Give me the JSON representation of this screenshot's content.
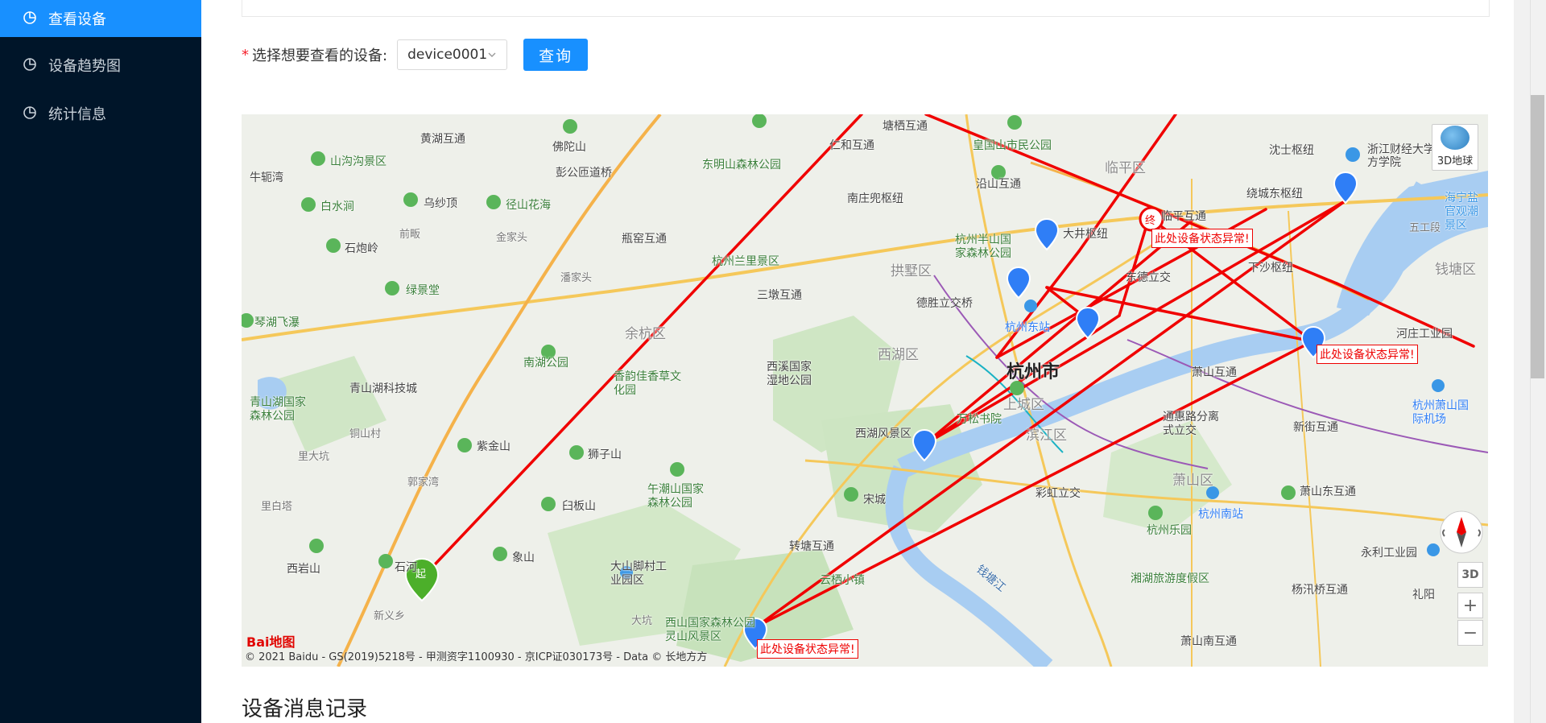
{
  "sidebar": {
    "items": [
      {
        "label": "查看设备",
        "icon": "pie-chart-icon",
        "active": true
      },
      {
        "label": "设备趋势图",
        "icon": "pie-chart-icon",
        "active": false
      },
      {
        "label": "统计信息",
        "icon": "pie-chart-icon",
        "active": false
      }
    ]
  },
  "query": {
    "required_mark": "*",
    "label": "选择想要查看的设备:",
    "selected_device": "device0001",
    "button_label": "查询"
  },
  "map": {
    "title_3d": "3D地球",
    "ctrl_3d": "3D",
    "zoom_in": "+",
    "zoom_out": "−",
    "start_marker": "起",
    "end_marker": "终",
    "alert_text": "此处设备状态异常!",
    "city": "杭州市",
    "copyright": "© 2021 Baidu - GS(2019)5218号 - 甲测资字1100930 - 京ICP证030173号 - Data © 长地方方",
    "logo": "Bai地图",
    "labels": {
      "l1": "黄湖互通",
      "l2": "佛陀山",
      "l3": "塘栖互通",
      "l4": "仁和互通",
      "l5": "皇国山市民公园",
      "l6": "沈士枢纽",
      "l7": "浙江财经大学东方学院",
      "l8": "牛轭湾",
      "l9": "山沟沟景区",
      "l10": "彭公匝道桥",
      "l11": "东明山森林公园",
      "l12": "南庄兜枢纽",
      "l13": "沿山互通",
      "l14": "临平区",
      "l15": "绕城东枢纽",
      "l16": "白水涧",
      "l17": "乌纱顶",
      "l18": "径山花海",
      "l19": "临平互通",
      "l20": "大井枢纽",
      "l21": "五工段",
      "l22": "前畈",
      "l23": "金家头",
      "l24": "瓶窑互通",
      "l25": "杭州半山国家森林公园",
      "l26": "石炮岭",
      "l27": "杭州兰里景区",
      "l28": "东德立交",
      "l29": "下沙枢纽",
      "l30": "钱塘区",
      "l31": "潘家头",
      "l32": "拱墅区",
      "l33": "绿景堂",
      "l34": "三墩互通",
      "l35": "德胜立交桥",
      "l36": "琴湖飞瀑",
      "l37": "余杭区",
      "l38": "杭州东站",
      "l39": "河庄工业园",
      "l40": "南湖公园",
      "l41": "香韵佳香草文化园",
      "l42": "西溪国家湿地公园",
      "l43": "西湖区",
      "l44": "萧山互通",
      "l45": "青山湖科技城",
      "l46": "青山湖国家森林公园",
      "l47": "上城区",
      "l48": "杭州萧山国际机场",
      "l49": "铜山村",
      "l50": "万松书院",
      "l51": "滨江区",
      "l52": "通惠路分离式立交",
      "l53": "新街互通",
      "l54": "里大坑",
      "l55": "紫金山",
      "l56": "狮子山",
      "l57": "西湖风景区",
      "l58": "郭家湾",
      "l59": "午潮山国家森林公园",
      "l60": "萧山区",
      "l61": "里白塔",
      "l62": "臼板山",
      "l63": "宋城",
      "l64": "彩虹立交",
      "l65": "杭州南站",
      "l66": "萧山东互通",
      "l67": "转塘互通",
      "l68": "杭州乐园",
      "l69": "永利工业园",
      "l70": "西岩山",
      "l71": "石河",
      "l72": "象山",
      "l73": "大山脚村工业园区",
      "l74": "云栖小镇",
      "l75": "钱塘江",
      "l76": "湘湖旅游度假区",
      "l77": "杨汛桥互通",
      "l78": "新义乡",
      "l79": "大坑",
      "l80": "西山国家森林公园灵山风景区",
      "l81": "萧山南互通",
      "l82": "礼阳",
      "l83": "海宁盐官观潮景区"
    }
  },
  "section": {
    "title": "设备消息记录"
  },
  "colors": {
    "sidebar_bg": "#001529",
    "active": "#1890ff",
    "route_red": "#f00000",
    "marker_blue": "#2f7ef6",
    "marker_green": "#4caf2a"
  }
}
